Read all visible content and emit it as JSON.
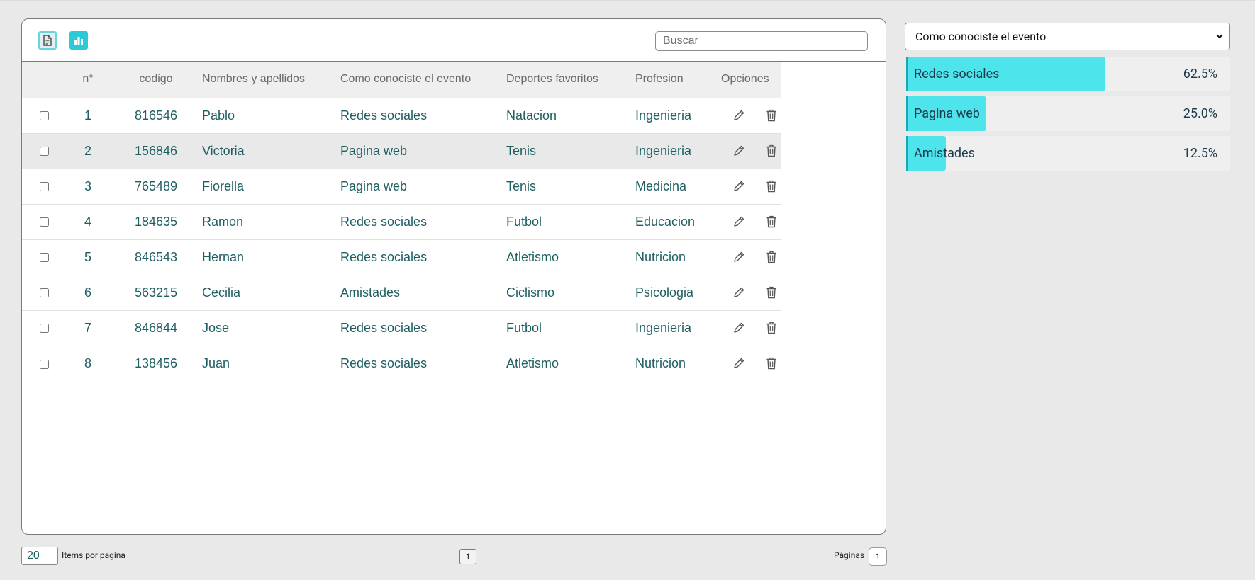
{
  "toolbar": {
    "table_icon": "document-icon",
    "chart_icon": "bar-chart-icon",
    "search_placeholder": "Buscar"
  },
  "table": {
    "columns": {
      "n": "n°",
      "codigo": "codigo",
      "nombres": "Nombres y apellidos",
      "como": "Como conociste el evento",
      "deportes": "Deportes favoritos",
      "profesion": "Profesion",
      "opciones": "Opciones"
    },
    "rows": [
      {
        "n": "1",
        "codigo": "816546",
        "nombre": "Pablo",
        "como": "Redes sociales",
        "deporte": "Natacion",
        "profesion": "Ingenieria"
      },
      {
        "n": "2",
        "codigo": "156846",
        "nombre": "Victoria",
        "como": "Pagina web",
        "deporte": "Tenis",
        "profesion": "Ingenieria"
      },
      {
        "n": "3",
        "codigo": "765489",
        "nombre": "Fiorella",
        "como": "Pagina web",
        "deporte": "Tenis",
        "profesion": "Medicina"
      },
      {
        "n": "4",
        "codigo": "184635",
        "nombre": "Ramon",
        "como": "Redes sociales",
        "deporte": "Futbol",
        "profesion": "Educacion"
      },
      {
        "n": "5",
        "codigo": "846543",
        "nombre": "Hernan",
        "como": "Redes sociales",
        "deporte": "Atletismo",
        "profesion": "Nutricion"
      },
      {
        "n": "6",
        "codigo": "563215",
        "nombre": "Cecilia",
        "como": "Amistades",
        "deporte": "Ciclismo",
        "profesion": "Psicologia"
      },
      {
        "n": "7",
        "codigo": "846844",
        "nombre": "Jose",
        "como": "Redes sociales",
        "deporte": "Futbol",
        "profesion": "Ingenieria"
      },
      {
        "n": "8",
        "codigo": "138456",
        "nombre": "Juan",
        "como": "Redes sociales",
        "deporte": "Atletismo",
        "profesion": "Nutricion"
      }
    ],
    "highlighted_row": 1,
    "edit_icon": "pencil-icon",
    "delete_icon": "trash-icon"
  },
  "footer": {
    "items_value": "20",
    "items_label": "Items por pagina",
    "current_page": "1",
    "pages_label": "Páginas",
    "pages_total": "1"
  },
  "summary": {
    "selected_field": "Como conociste el evento",
    "stats": [
      {
        "label": "Redes sociales",
        "percent": "62.5%",
        "fraction": 0.625
      },
      {
        "label": "Pagina web",
        "percent": "25.0%",
        "fraction": 0.25
      },
      {
        "label": "Amistades",
        "percent": "12.5%",
        "fraction": 0.125
      }
    ]
  },
  "colors": {
    "accent": "#2ccad6",
    "bar_fill": "#4ee4ec",
    "cell_text": "#1f5f62"
  }
}
